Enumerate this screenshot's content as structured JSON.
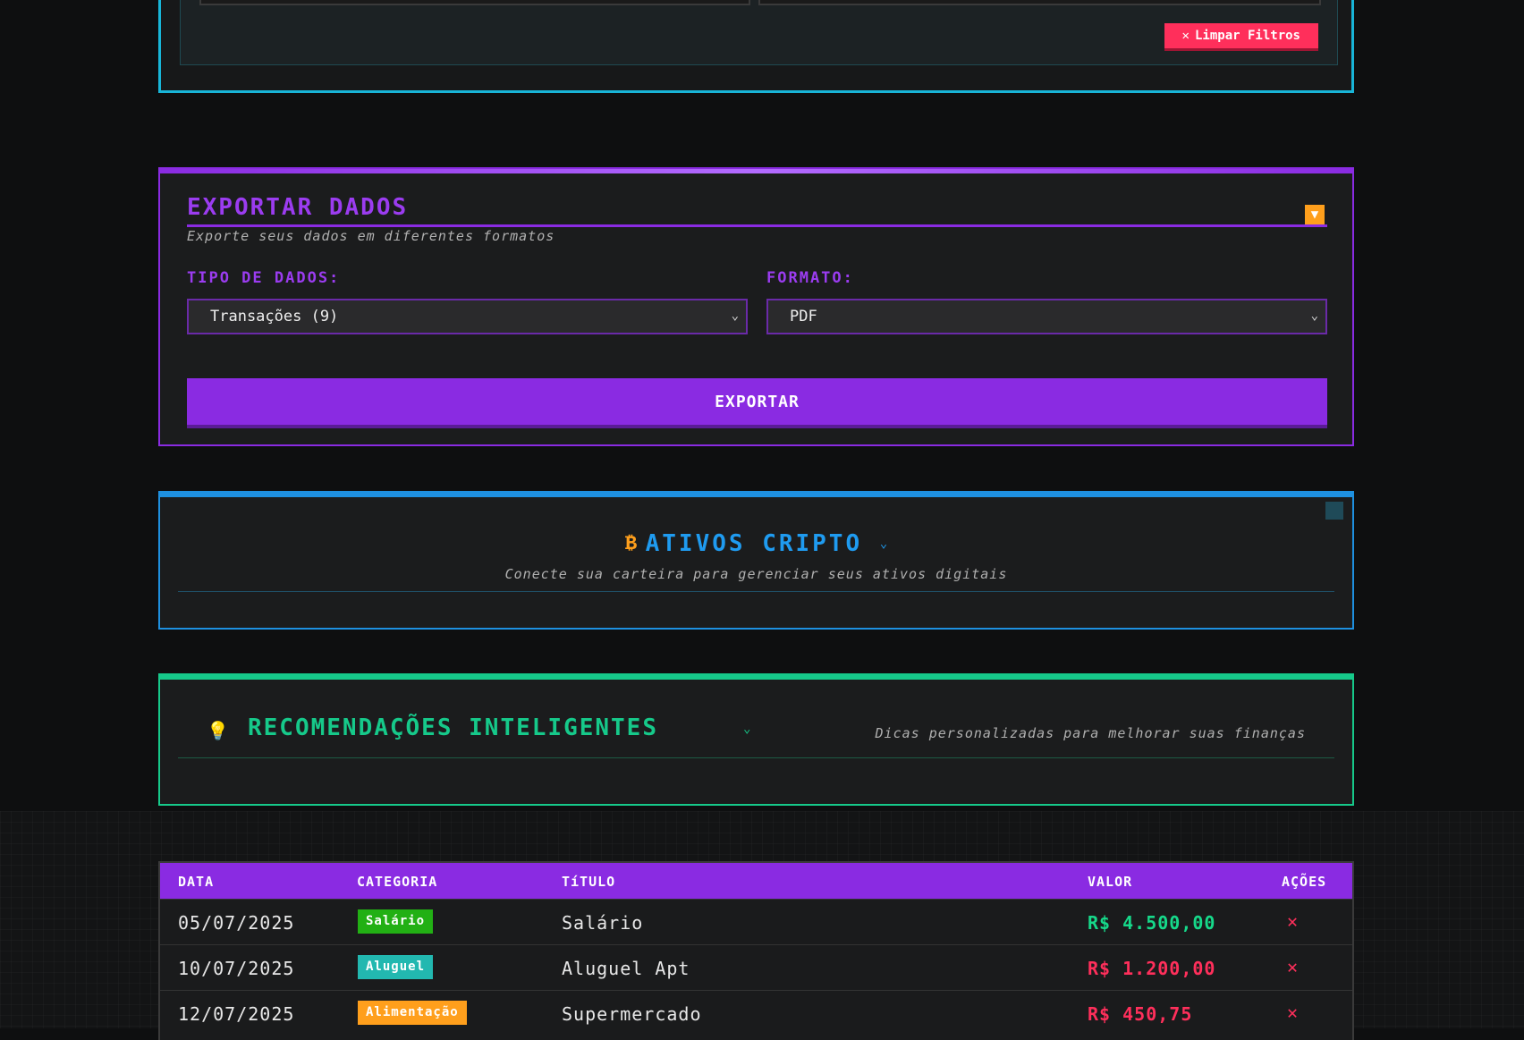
{
  "filters": {
    "clear_label": "Limpar Filtros",
    "clear_icon": "✕"
  },
  "export": {
    "title": "EXPORTAR DADOS",
    "subtitle": "Exporte seus dados em diferentes formatos",
    "toggle_icon": "▼",
    "data_type_label": "TIPO DE DADOS:",
    "data_type_value": "Transações (9)",
    "format_label": "FORMATO:",
    "format_value": "PDF",
    "button_label": "EXPORTAR",
    "accent": "#8a2be2"
  },
  "crypto": {
    "icon": "₿",
    "title": "ATIVOS CRIPTO",
    "subtitle": "Conecte sua carteira para gerenciar seus ativos digitais",
    "accent": "#1e90e0"
  },
  "recommendations": {
    "icon": "💡",
    "title": "RECOMENDAÇÕES INTELIGENTES",
    "subtitle": "Dicas personalizadas para melhorar suas finanças",
    "accent": "#16c98a"
  },
  "table": {
    "headers": [
      "DATA",
      "CATEGORIA",
      "TíTULO",
      "VALOR",
      "AÇÕES"
    ],
    "rows": [
      {
        "date": "05/07/2025",
        "category": "Salário",
        "category_color": "#22b014",
        "title": "Salário",
        "amount": "R$ 4.500,00",
        "amount_color": "#16d98a",
        "action_icon": "✕"
      },
      {
        "date": "10/07/2025",
        "category": "Aluguel",
        "category_color": "#22b8b0",
        "title": "Aluguel Apt",
        "amount": "R$ 1.200,00",
        "amount_color": "#ff2f5b",
        "action_icon": "✕"
      },
      {
        "date": "12/07/2025",
        "category": "Alimentação",
        "category_color": "#ff9f1c",
        "title": "Supermercado",
        "amount": "R$ 450,75",
        "amount_color": "#ff2f5b",
        "action_icon": "✕"
      }
    ]
  }
}
